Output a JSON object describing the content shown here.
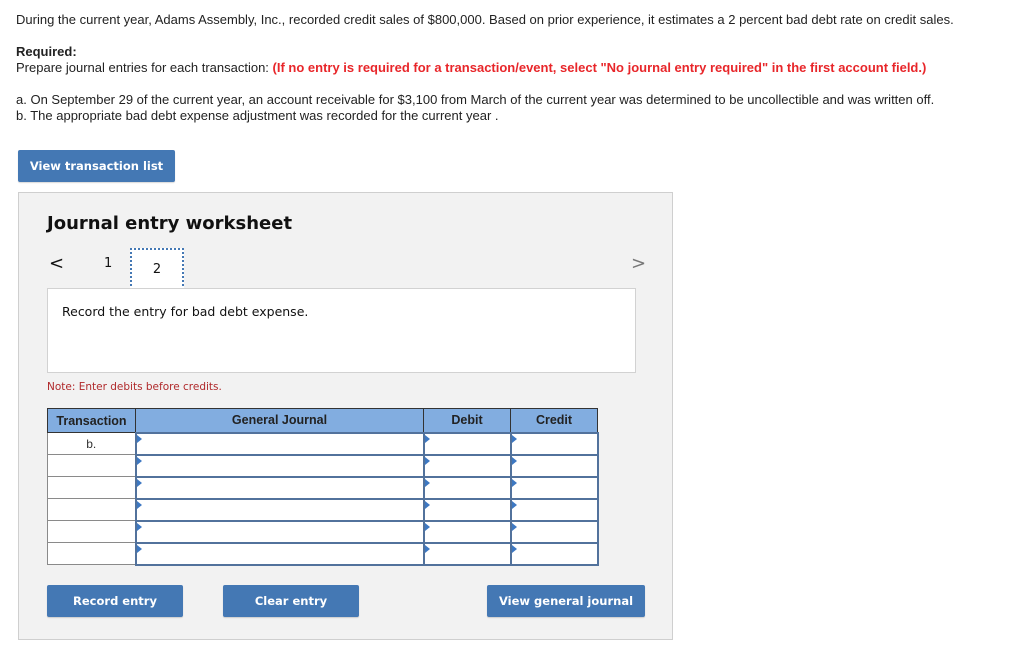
{
  "problem": {
    "intro": "During the current year, Adams Assembly, Inc., recorded credit sales of $800,000. Based on prior experience, it estimates a 2 percent bad debt rate on credit sales.",
    "required_title": "Required:",
    "instruction": "Prepare journal entries for each transaction: ",
    "instruction_highlight": "(If no entry is required for a transaction/event, select \"No journal entry required\" in the first account field.)",
    "items": [
      "a. On September 29 of the current year, an account receivable for  $3,100 from March of the current year was determined to be uncollectible and was written off.",
      "b. The appropriate bad debt expense adjustment was recorded for the current year ."
    ]
  },
  "buttons": {
    "view_transaction_list": "View transaction list",
    "record_entry": "Record entry",
    "clear_entry": "Clear entry",
    "view_general_journal": "View general journal"
  },
  "worksheet": {
    "title": "Journal entry worksheet",
    "nav": {
      "prev_icon": "<",
      "next_icon": ">",
      "pages": [
        "1",
        "2"
      ],
      "current_page": "2"
    },
    "description": "Record the entry for bad debt expense.",
    "note": "Note: Enter debits before credits.",
    "table": {
      "headers": [
        "Transaction",
        "General Journal",
        "Debit",
        "Credit"
      ],
      "rows": [
        {
          "transaction": "b.",
          "account": "",
          "debit": "",
          "credit": ""
        },
        {
          "transaction": "",
          "account": "",
          "debit": "",
          "credit": ""
        },
        {
          "transaction": "",
          "account": "",
          "debit": "",
          "credit": ""
        },
        {
          "transaction": "",
          "account": "",
          "debit": "",
          "credit": ""
        },
        {
          "transaction": "",
          "account": "",
          "debit": "",
          "credit": ""
        },
        {
          "transaction": "",
          "account": "",
          "debit": "",
          "credit": ""
        }
      ]
    }
  },
  "colors": {
    "button_bg": "#4478b4",
    "header_bg": "#82ade0",
    "instruction_red": "#e8262a",
    "note_red": "#b0292b",
    "panel_bg": "#f2f2f2"
  }
}
